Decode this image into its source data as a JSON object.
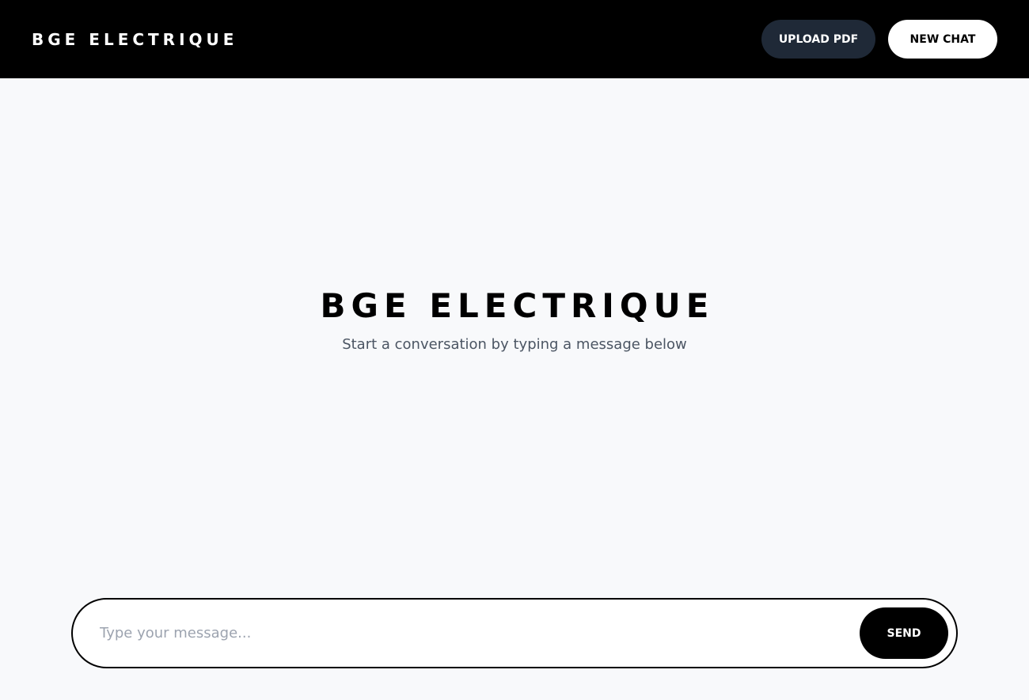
{
  "header": {
    "brand": "BGE ELECTRIQUE",
    "upload_label": "UPLOAD PDF",
    "new_chat_label": "NEW CHAT"
  },
  "hero": {
    "title": "BGE ELECTRIQUE",
    "subtitle": "Start a conversation by typing a message below"
  },
  "composer": {
    "placeholder": "Type your message...",
    "value": "",
    "send_label": "SEND"
  },
  "colors": {
    "header_bg": "#000000",
    "page_bg": "#f8f9fb",
    "upload_button_bg": "#1f2937",
    "new_chat_button_bg": "#ffffff",
    "send_button_bg": "#000000",
    "subtitle_text": "#4b5563",
    "placeholder_text": "#9ca3af"
  }
}
